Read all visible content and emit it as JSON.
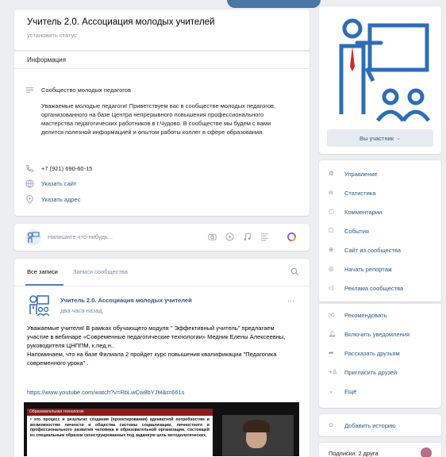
{
  "group": {
    "title": "Учитель 2.0. Ассоциация молодых учителей",
    "status": "установить статус"
  },
  "info": {
    "header": "Информация",
    "subtitle": "Сообщество молодых педагогов",
    "description": "Уважаемые молодые педагоги! Приветствуем вас в сообществе молодых педагогов, организованного на базе Центра непрерывного повышения профессионального мастерства педагогических работников в г.Чудово. В сообществе мы будем с вами делится полезной информацией и опытом работы коллег в сфере образования.",
    "phone": "+7 (921) 690-60-15",
    "site": "Указать сайт",
    "address": "Указать адрес"
  },
  "composer": {
    "placeholder": "Напишите что-нибудь..."
  },
  "tabs": {
    "all": "Все записи",
    "community": "Записи сообщества"
  },
  "post": {
    "author": "Учитель 2.0. Ассоциация молодых учителей",
    "time": "два часа назад",
    "text": "Уважаемые учителя! В рамках обучающего модуля \" Эффективный учитель\" предлагаем участие в вебинаре «Современные педагогические технологии» Медник Елены Алексеевны, руководителя ЦНППМ, к.пед.н..\nНапоминаем, что на базе Филиала 2 пройдет курс повышения квалификации \"Педагогика современного урока\" .",
    "link": "https://www.youtube.com/watch?v=RbLwCw8bYJM&t=661s",
    "slide_header": "Образовательная технология",
    "slide_text": "• это процесс и результат создания (проектирования) адекватной потребностям и возможностям личности и общества системы социализации, личностного и профессионального развития человека в образовательной организации, состоящей из специальным образом сконструированных под заданную цель методологических,"
  },
  "sidebar": {
    "member_button": "Вы участник",
    "menu": [
      {
        "label": "Управление",
        "icon": "gear-icon"
      },
      {
        "label": "Статистика",
        "icon": "stats-icon"
      },
      {
        "label": "Комментарии",
        "icon": "comment-icon"
      },
      {
        "label": "События",
        "icon": "events-icon"
      },
      {
        "label": "Сайт из сообщества",
        "icon": "globe-icon"
      },
      {
        "label": "Начать репортаж",
        "icon": "broadcast-icon"
      },
      {
        "label": "Реклама сообщества",
        "icon": "megaphone-icon"
      }
    ],
    "menu2": [
      {
        "label": "Рекомендовать",
        "icon": "thumb-icon"
      },
      {
        "label": "Включить уведомления",
        "icon": "bell-icon"
      },
      {
        "label": "Рассказать друзьям",
        "icon": "share-icon"
      },
      {
        "label": "Пригласить друзей",
        "icon": "invite-icon"
      },
      {
        "label": "Ещё",
        "icon": "chevron-down-icon"
      }
    ],
    "story": "Добавить историю",
    "bottom": "Подписки: 2 друга"
  },
  "colors": {
    "accent": "#2a5885",
    "logo_blue": "#2e6db5",
    "logo_red": "#d62828"
  }
}
